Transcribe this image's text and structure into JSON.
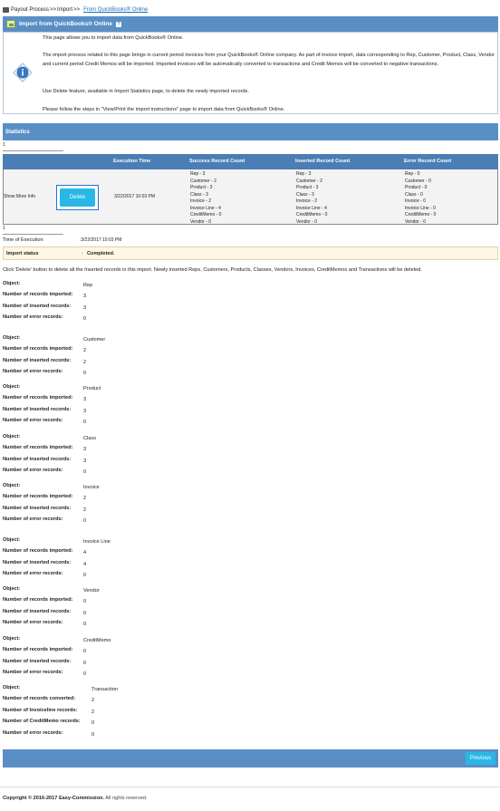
{
  "breadcrumb": {
    "item1": "Payout Process",
    "sep1": ">>",
    "item2": "Import",
    "sep2": ">>",
    "link": "From QuickBooks® Online"
  },
  "import_header": {
    "title": "Import from QuickBooks® Online",
    "help_glyph": "?"
  },
  "info": {
    "p1": "This page allows you to import data from QuickBooks® Online.",
    "p2": "The import process related to this page brings in current period invoices from your QuickBooks® Online company. As part of invoice import, data corresponding to Rep, Customer, Product, Class, Vendor and current period Credit Memos will be imported. Imported invoices will be automatically converted to transactions and Credit Memos will be converted to negative transactions.",
    "p3": "Use Delete feature, available in Import Statistics page, to delete the newly imported records.",
    "p4": "Please follow the steps in \"View/Print the import instructions\" page to import data from QuickBooks® Online."
  },
  "statistics": {
    "title": "Statistics",
    "pager_top": "1",
    "pager_bottom": "1",
    "columns": [
      "Execution Time",
      "Success Record Count",
      "Inserted Record Count",
      "Error Record Count"
    ],
    "row": {
      "show_more": "Show More Info",
      "delete_label": "Delete",
      "execution_time": "3/22/2017 10:03 PM",
      "success": [
        "Rep - 3",
        "Customer - 2",
        "Product - 3",
        "Class - 3",
        "Invoice - 2",
        "Invoice Line - 4",
        "CreditMemo - 0",
        "Vendor - 0"
      ],
      "inserted": [
        "Rep - 3",
        "Customer - 2",
        "Product - 3",
        "Class - 3",
        "Invoice - 2",
        "Invoice Line - 4",
        "CreditMemo - 0",
        "Vendor - 0"
      ],
      "error": [
        "Rep - 0",
        "Customer - 0",
        "Product - 0",
        "Class - 0",
        "Invoice - 0",
        "Invoice Line - 0",
        "CreditMemo - 0",
        "Vendor - 0"
      ]
    }
  },
  "execution": {
    "label": "Time of Execution",
    "value": ":3/22/2017 10:03 PM"
  },
  "import_status": {
    "label": "Import status",
    "colon": ":",
    "value": "Completed."
  },
  "delete_note": "Click 'Delete' button to delete all the Inserted records in this import. Newly inserted Reps, Customers, Products, Classes, Vendors, Invoices, CreditMemos and Transactions will be deleted.",
  "objects": [
    {
      "name": "Rep",
      "rows": [
        [
          "Number of records imported:",
          "3"
        ],
        [
          "Number of inserted records:",
          "3"
        ],
        [
          "Number of error records:",
          "0"
        ]
      ]
    },
    {
      "name": "Customer",
      "rows": [
        [
          "Number of records imported:",
          "2"
        ],
        [
          "Number of inserted records:",
          "2"
        ],
        [
          "Number of error records:",
          "0"
        ]
      ]
    },
    {
      "name": "Product",
      "rows": [
        [
          "Number of records imported:",
          "3"
        ],
        [
          "Number of inserted records:",
          "3"
        ],
        [
          "Number of error records:",
          "0"
        ]
      ]
    },
    {
      "name": "Class",
      "rows": [
        [
          "Number of records imported:",
          "3"
        ],
        [
          "Number of inserted records:",
          "3"
        ],
        [
          "Number of error records:",
          "0"
        ]
      ]
    },
    {
      "name": "Invoice",
      "rows": [
        [
          "Number of records imported:",
          "2"
        ],
        [
          "Number of inserted records:",
          "2"
        ],
        [
          "Number of error records:",
          "0"
        ]
      ]
    },
    {
      "name": "Invoice Line",
      "rows": [
        [
          "Number of records imported:",
          "4"
        ],
        [
          "Number of inserted records:",
          "4"
        ],
        [
          "Number of error records:",
          "0"
        ]
      ]
    },
    {
      "name": "Vendor",
      "rows": [
        [
          "Number of records imported:",
          "0"
        ],
        [
          "Number of inserted records:",
          "0"
        ],
        [
          "Number of error records:",
          "0"
        ]
      ]
    },
    {
      "name": "CreditMemo",
      "rows": [
        [
          "Number of records imported:",
          "0"
        ],
        [
          "Number of inserted records:",
          "0"
        ],
        [
          "Number of error records:",
          "0"
        ]
      ]
    },
    {
      "name": "Transaction",
      "rows": [
        [
          "Number of records converted:",
          "2"
        ],
        [
          "Number of Invoiceline records:",
          "2"
        ],
        [
          "Number of CreditMemo records:",
          "0"
        ],
        [
          "Number of error records:",
          "0"
        ]
      ]
    }
  ],
  "object_label": "Object:",
  "previous_label": "Previous",
  "copyright": {
    "bold": "Copyright © 2016-2017 Easy-Commission.",
    "rest": " All rights reserved."
  },
  "colors": {
    "header_blue": "#5a8fc6",
    "button_cyan": "#29b7e6",
    "status_bg": "#fdf7e3"
  },
  "icons": {
    "breadcrumb": "briefcase-icon",
    "quickbooks": "quickbooks-icon",
    "info": "info-icon",
    "help": "help-icon"
  }
}
